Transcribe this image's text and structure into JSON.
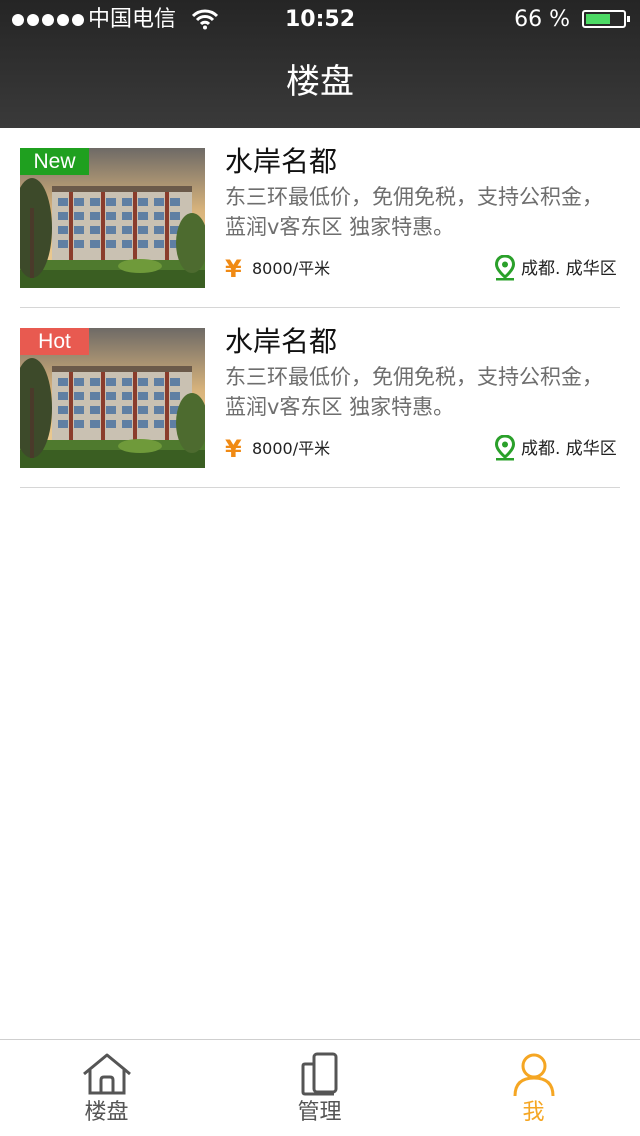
{
  "status_bar": {
    "carrier": "中国电信",
    "time": "10:52",
    "battery": "66 %",
    "battery_level": 0.66
  },
  "nav": {
    "title": "楼盘"
  },
  "listings": [
    {
      "tag": "New",
      "tag_color": "#1fa01f",
      "title": "水岸名都",
      "description": "东三环最低价，免佣免税，支持公积金，蓝润v客东区 独家特惠。",
      "price": "8000/平米",
      "location": "成都. 成华区"
    },
    {
      "tag": "Hot",
      "tag_color": "#e85a50",
      "title": "水岸名都",
      "description": "东三环最低价，免佣免税，支持公积金，蓝润v客东区 独家特惠。",
      "price": "8000/平米",
      "location": "成都. 成华区"
    }
  ],
  "price_icon": "¥",
  "tabbar": {
    "items": [
      {
        "label": "楼盘",
        "icon": "home-icon",
        "active": false
      },
      {
        "label": "管理",
        "icon": "phone-icon",
        "active": false
      },
      {
        "label": "我",
        "icon": "user-icon",
        "active": true
      }
    ],
    "active_color": "#f5a623",
    "inactive_color": "#555555"
  }
}
